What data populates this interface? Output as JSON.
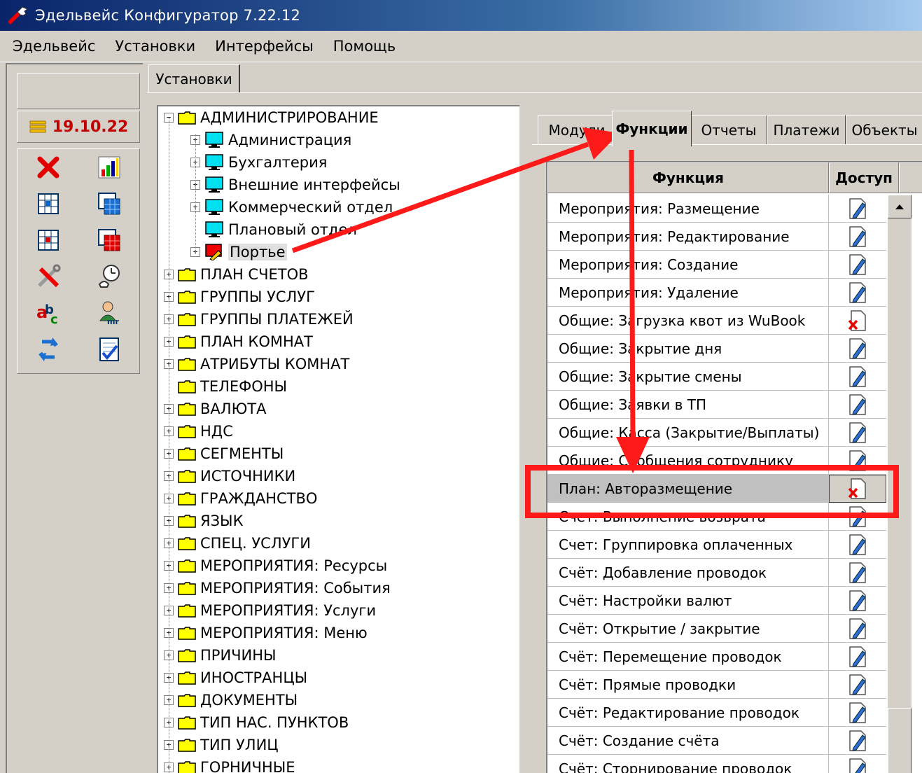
{
  "window": {
    "title": "Эдельвейс Конфигуратор 7.22.12"
  },
  "menu": [
    "Эдельвейс",
    "Установки",
    "Интерфейсы",
    "Помощь"
  ],
  "left": {
    "date": "19.10.22",
    "tools": [
      "delete-icon",
      "chart-icon",
      "grid-icon",
      "table-icon",
      "grid-red-icon",
      "table-red-icon",
      "tools-icon",
      "clock-icon",
      "abc-icon",
      "user-icon",
      "refresh-icon",
      "checklist-icon"
    ]
  },
  "main_tab": "Установки",
  "tree": {
    "root": "АДМИНИСТРИРОВАНИЕ",
    "children": [
      "Администрация",
      "Бухгалтерия",
      "Внешние интерфейсы",
      "Коммерческий отдел",
      "Плановый отдел",
      "Портье"
    ],
    "folders": [
      "ПЛАН СЧЕТОВ",
      "ГРУППЫ УСЛУГ",
      "ГРУППЫ ПЛАТЕЖЕЙ",
      "ПЛАН КОМНАТ",
      "АТРИБУТЫ КОМНАТ",
      "ТЕЛЕФОНЫ",
      "ВАЛЮТА",
      "НДС",
      "СЕГМЕНТЫ",
      "ИСТОЧНИКИ",
      "ГРАЖДАНСТВО",
      "ЯЗЫК",
      "СПЕЦ. УСЛУГИ",
      "МЕРОПРИЯТИЯ: Ресурсы",
      "МЕРОПРИЯТИЯ: События",
      "МЕРОПРИЯТИЯ: Услуги",
      "МЕРОПРИЯТИЯ: Меню",
      "ПРИЧИНЫ",
      "ИНОСТРАНЦЫ",
      "ДОКУМЕНТЫ",
      "ТИП НАС. ПУНКТОВ",
      "ТИП УЛИЦ",
      "ГОРНИЧНЫЕ"
    ]
  },
  "tabs": [
    "Модули",
    "Функции",
    "Отчеты",
    "Платежи",
    "Объекты"
  ],
  "grid": {
    "headers": [
      "Функция",
      "Доступ"
    ],
    "rows": [
      {
        "name": "Мероприятия: Размещение",
        "access": "allowed"
      },
      {
        "name": "Мероприятия: Редактирование",
        "access": "allowed"
      },
      {
        "name": "Мероприятия: Создание",
        "access": "allowed"
      },
      {
        "name": "Мероприятия: Удаление",
        "access": "allowed"
      },
      {
        "name": "Общие: Загрузка квот из WuBook",
        "access": "denied"
      },
      {
        "name": "Общие: Закрытие дня",
        "access": "allowed"
      },
      {
        "name": "Общие: Закрытие смены",
        "access": "allowed"
      },
      {
        "name": "Общие: Заявки в ТП",
        "access": "allowed"
      },
      {
        "name": "Общие: Касса (Закрытие/Выплаты)",
        "access": "allowed"
      },
      {
        "name": "Общие: Сообщения сотруднику",
        "access": "allowed"
      },
      {
        "name": "План: Авторазмещение",
        "access": "denied"
      },
      {
        "name": "Счет: Выполнение возврата",
        "access": "allowed"
      },
      {
        "name": "Счет: Группировка оплаченных",
        "access": "allowed"
      },
      {
        "name": "Счёт: Добавление проводок",
        "access": "allowed"
      },
      {
        "name": "Счёт: Настройки валют",
        "access": "allowed"
      },
      {
        "name": "Счёт: Открытие / закрытие",
        "access": "allowed"
      },
      {
        "name": "Счёт: Перемещение проводок",
        "access": "allowed"
      },
      {
        "name": "Счёт: Прямые проводки",
        "access": "allowed"
      },
      {
        "name": "Счёт: Редактирование проводок",
        "access": "allowed"
      },
      {
        "name": "Счёт: Создание счёта",
        "access": "allowed"
      },
      {
        "name": "Счёт: Сторнирование проводок",
        "access": "allowed"
      }
    ]
  },
  "colors": {
    "highlight": "#ff1a1a",
    "date": "#c00000"
  }
}
